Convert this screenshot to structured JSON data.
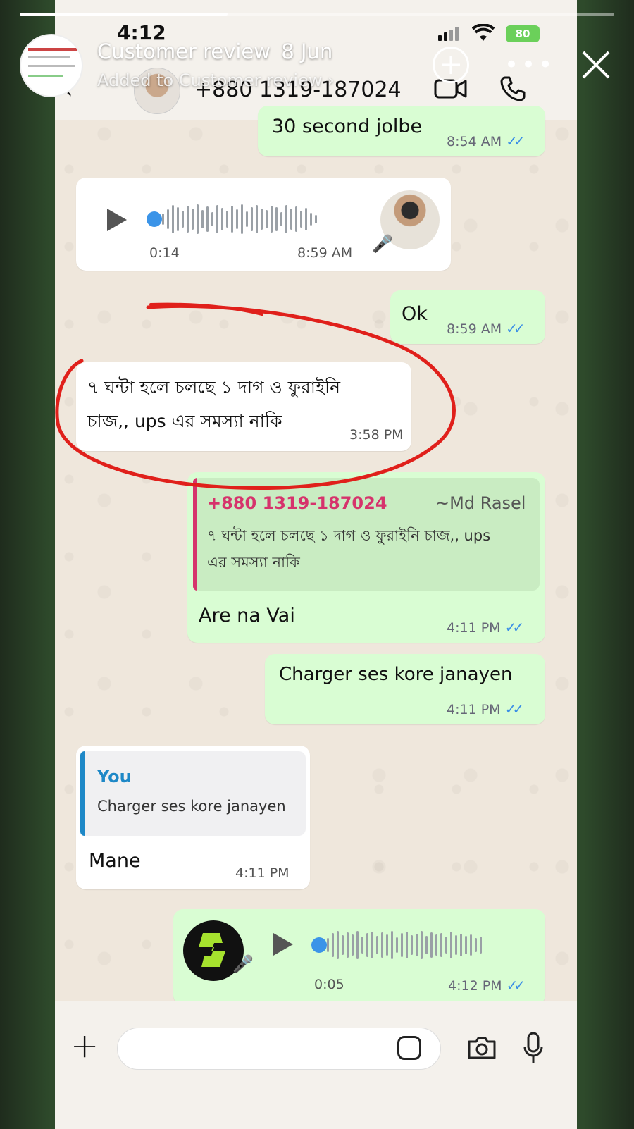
{
  "story": {
    "title": "Customer review",
    "date": "8 Jun",
    "subtitle": "Added to Customer review",
    "progress": 0.35
  },
  "status_bar": {
    "time": "4:12",
    "battery": "80"
  },
  "chat_header": {
    "contact": "+880 1319-187024"
  },
  "messages": {
    "m1": {
      "text": "30 second jolbe",
      "time": "8:54 AM"
    },
    "m2": {
      "duration": "0:14",
      "time": "8:59 AM"
    },
    "m3": {
      "text": "Ok",
      "time": "8:59 AM"
    },
    "m4": {
      "line1": "৭ ঘন্টা হলে চলছে ১ দাগ ও ফুরাইনি",
      "line2": "চাজ,, ups এর সমস্যা নাকি",
      "time": "3:58 PM"
    },
    "m5": {
      "quote_sender": "+880 1319-187024",
      "quote_name": "~Md Rasel",
      "quote_line1": "৭ ঘন্টা হলে চলছে ১ দাগ ও ফুরাইনি চাজ,, ups",
      "quote_line2": "এর সমস্যা নাকি",
      "text": "Are na Vai",
      "time": "4:11 PM"
    },
    "m6": {
      "text": "Charger ses kore janayen",
      "time": "4:11 PM"
    },
    "m7": {
      "quote_sender": "You",
      "quote_text": "Charger ses kore janayen",
      "text": "Mane",
      "time": "4:11 PM"
    },
    "m8": {
      "duration": "0:05",
      "time": "4:12 PM"
    }
  },
  "colors": {
    "outgoing": "#d9fdd3",
    "incoming": "#ffffff",
    "ticks": "#3a8ee6",
    "annotation": "#e0201b",
    "quote_pink": "#d6336c",
    "quote_blue": "#1e88c7"
  }
}
